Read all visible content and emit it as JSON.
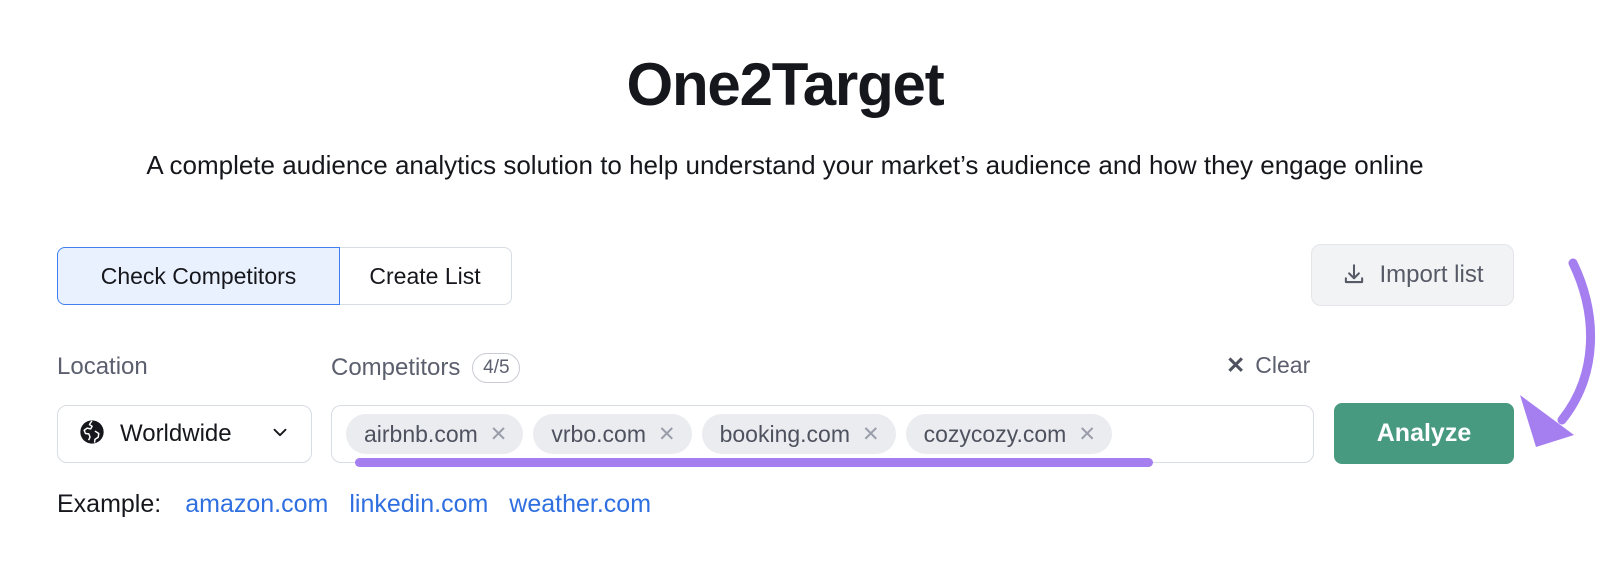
{
  "header": {
    "title": "One2Target",
    "subtitle": "A complete audience analytics solution to help understand your market’s audience and how they engage online"
  },
  "mode_toggle": {
    "options": [
      {
        "label": "Check Competitors",
        "selected": true
      },
      {
        "label": "Create List",
        "selected": false
      }
    ]
  },
  "import": {
    "label": "Import list",
    "icon": "download-icon"
  },
  "fields": {
    "location_label": "Location",
    "competitors_label": "Competitors",
    "competitors_count": "4/5",
    "clear_label": "Clear",
    "clear_icon": "close-icon"
  },
  "location": {
    "value": "Worldwide",
    "icon": "globe-icon",
    "chevron": "chevron-down-icon"
  },
  "competitors": {
    "placeholder": "",
    "chips": [
      {
        "label": "airbnb.com",
        "remove_icon": "close-icon"
      },
      {
        "label": "vrbo.com",
        "remove_icon": "close-icon"
      },
      {
        "label": "booking.com",
        "remove_icon": "close-icon"
      },
      {
        "label": "cozycozy.com",
        "remove_icon": "close-icon"
      }
    ]
  },
  "analyze": {
    "label": "Analyze"
  },
  "examples": {
    "label": "Example:",
    "links": [
      "amazon.com",
      "linkedin.com",
      "weather.com"
    ]
  },
  "annotations": {
    "color": "#a57ef0",
    "underline_target": "competitors-input",
    "arrow_target": "analyze-button"
  }
}
